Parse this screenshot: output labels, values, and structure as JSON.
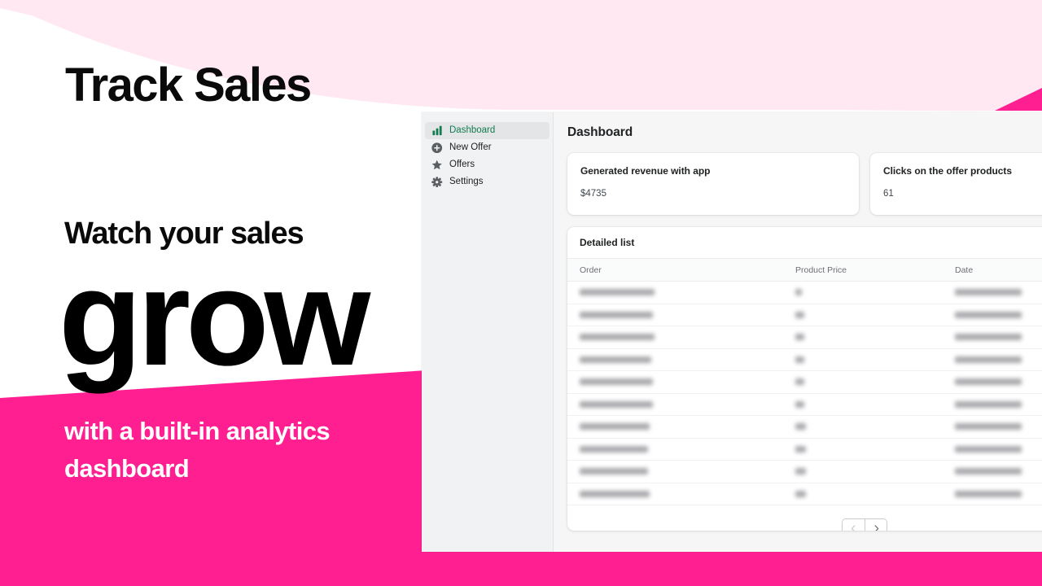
{
  "promo": {
    "headline_top": "Track Sales",
    "headline_mid": "Watch your sales",
    "headline_big": "grow",
    "subline_line1": "with a built-in analytics",
    "subline_line2": "dashboard",
    "colors": {
      "magenta": "#ff1f91",
      "pale_pink": "#ffe8f2",
      "white": "#ffffff",
      "ink": "#0a0a0a"
    }
  },
  "app": {
    "sidebar": {
      "items": [
        {
          "label": "Dashboard",
          "icon": "bar-chart-icon",
          "active": true
        },
        {
          "label": "New Offer",
          "icon": "plus-circle-icon",
          "active": false
        },
        {
          "label": "Offers",
          "icon": "star-icon",
          "active": false
        },
        {
          "label": "Settings",
          "icon": "gear-icon",
          "active": false
        }
      ],
      "active_color": "#117c51"
    },
    "main": {
      "page_title": "Dashboard",
      "metric_cards": [
        {
          "title": "Generated revenue with app",
          "value": "$4735"
        },
        {
          "title": "Clicks on the offer products",
          "value": "61"
        }
      ],
      "detail": {
        "title": "Detailed list",
        "columns": [
          "Order",
          "Product Price",
          "Date"
        ],
        "rows": [
          {
            "order": "",
            "price": "",
            "date": "",
            "redacted": true
          },
          {
            "order": "",
            "price": "",
            "date": "",
            "redacted": true
          },
          {
            "order": "",
            "price": "",
            "date": "",
            "redacted": true
          },
          {
            "order": "",
            "price": "",
            "date": "",
            "redacted": true
          },
          {
            "order": "",
            "price": "",
            "date": "",
            "redacted": true
          },
          {
            "order": "",
            "price": "",
            "date": "",
            "redacted": true
          },
          {
            "order": "",
            "price": "",
            "date": "",
            "redacted": true
          },
          {
            "order": "",
            "price": "",
            "date": "",
            "redacted": true
          },
          {
            "order": "",
            "price": "",
            "date": "",
            "redacted": true
          },
          {
            "order": "",
            "price": "",
            "date": "",
            "redacted": true
          }
        ]
      },
      "pagination": {
        "prev_icon": "chevron-left-icon",
        "next_icon": "chevron-right-icon",
        "prev_enabled": false,
        "next_enabled": true
      }
    }
  }
}
